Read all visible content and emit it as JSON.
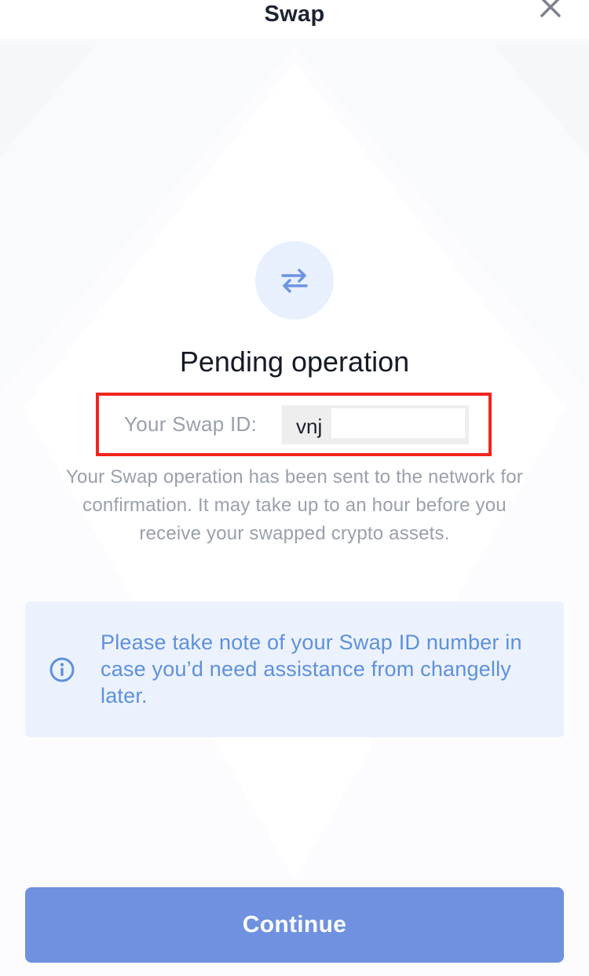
{
  "header": {
    "title": "Swap"
  },
  "status": {
    "title": "Pending operation",
    "swap_id_label": "Your Swap ID:",
    "swap_id_value": "vnj",
    "description": "Your Swap operation has been sent to the network for confirmation. It may take up to an hour before you receive your swapped crypto assets."
  },
  "note": {
    "text": "Please take note of your Swap ID number in case you’d need assistance from changelly later."
  },
  "actions": {
    "continue_label": "Continue"
  },
  "colors": {
    "accent": "#6f91df",
    "highlight_border": "#f1251c",
    "note_background": "#ecf2fd",
    "note_text": "#5e90dc"
  },
  "icons": {
    "close": "close-icon",
    "swap": "swap-arrows-icon",
    "info": "info-icon"
  }
}
